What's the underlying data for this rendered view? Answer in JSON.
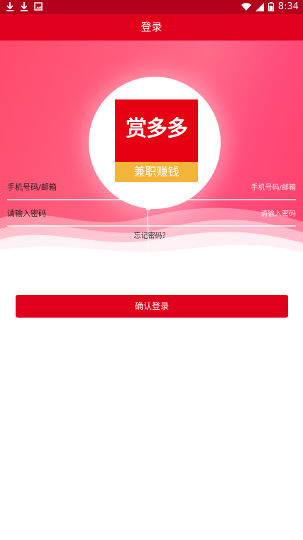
{
  "status_bar": {
    "time": "8:34",
    "left_icons": [
      "download-icon",
      "download-icon",
      "image-icon"
    ],
    "right_icons": [
      "wifi-icon",
      "signal-icon",
      "battery-icon"
    ]
  },
  "toolbar": {
    "title": "登录"
  },
  "logo": {
    "brand": "赏多多",
    "tagline": "兼职赚钱"
  },
  "form": {
    "account_label": "手机号码/邮箱",
    "account_placeholder": "手机号码/邮箱",
    "password_label": "请输入密码",
    "password_placeholder": "请输入密码",
    "forgot_link": "忘记密码？"
  },
  "login_button": "确认登录",
  "colors": {
    "primary": "#e0001c",
    "status_bar": "#b3001d",
    "hero": "#ff5d7d",
    "ribbon": "#f4b43a"
  }
}
